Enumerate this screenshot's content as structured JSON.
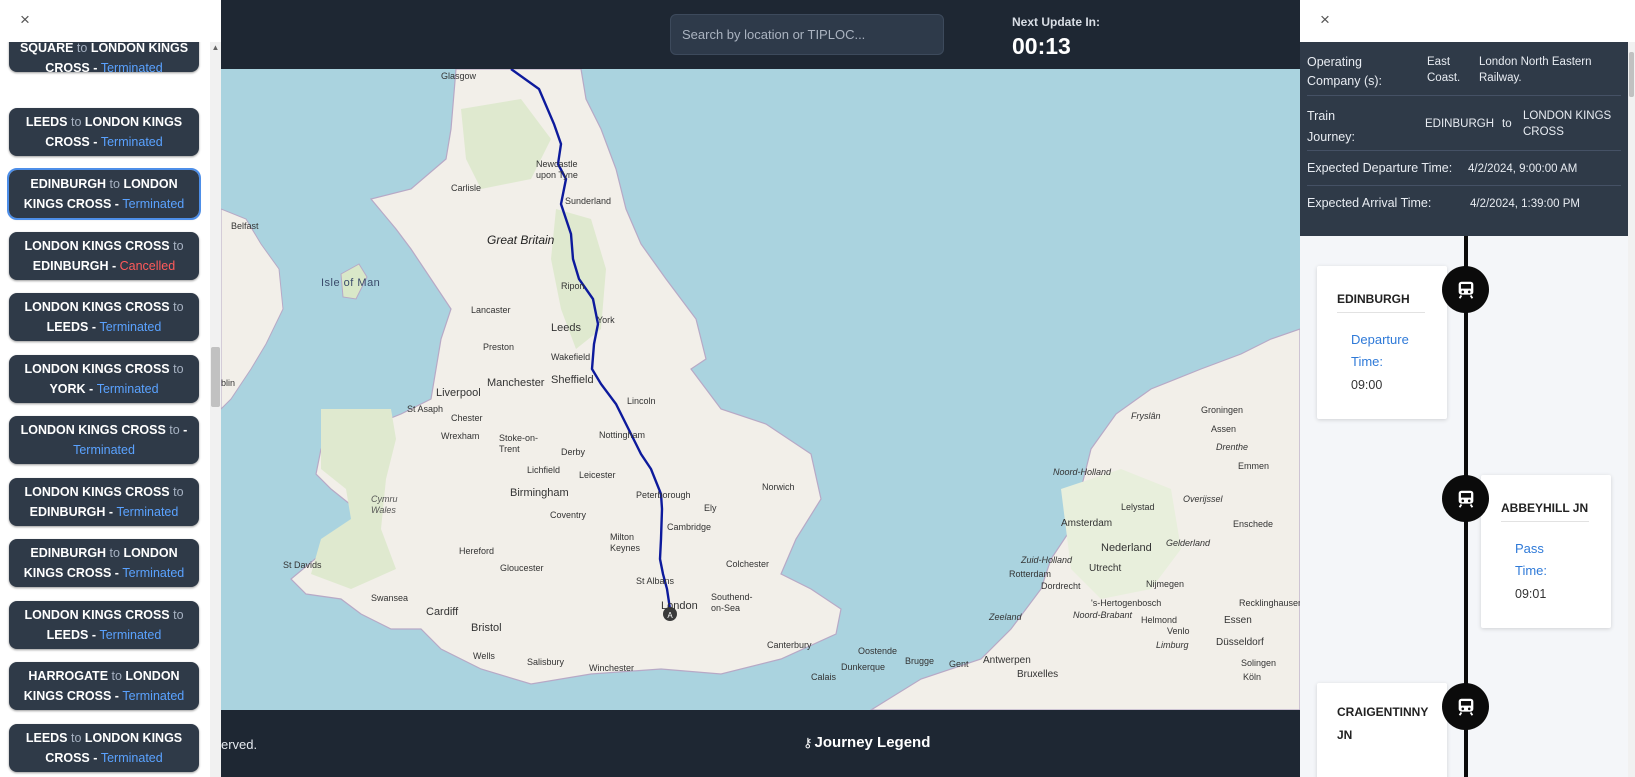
{
  "left_panel": {
    "close_label": "×",
    "journeys": [
      {
        "from": "BRADFORD FORSTER SQUARE",
        "to": "LONDON KINGS CROSS",
        "status": "Terminated"
      },
      {
        "from": "LEEDS",
        "to": "LONDON KINGS CROSS",
        "status": "Terminated"
      },
      {
        "from": "EDINBURGH",
        "to": "LONDON KINGS CROSS",
        "status": "Terminated"
      },
      {
        "from": "LONDON KINGS CROSS",
        "to": "EDINBURGH",
        "status": "Cancelled"
      },
      {
        "from": "LONDON KINGS CROSS",
        "to": "LEEDS",
        "status": "Terminated"
      },
      {
        "from": "LONDON KINGS CROSS",
        "to": "YORK",
        "status": "Terminated"
      },
      {
        "from": "LONDON KINGS CROSS",
        "to": "",
        "status": "Terminated"
      },
      {
        "from": "LONDON KINGS CROSS",
        "to": "EDINBURGH",
        "status": "Terminated"
      },
      {
        "from": "EDINBURGH",
        "to": "LONDON KINGS CROSS",
        "status": "Terminated"
      },
      {
        "from": "LONDON KINGS CROSS",
        "to": "LEEDS",
        "status": "Terminated"
      },
      {
        "from": "HARROGATE",
        "to": "LONDON KINGS CROSS",
        "status": "Terminated"
      },
      {
        "from": "LEEDS",
        "to": "LONDON KINGS CROSS",
        "status": "Terminated"
      }
    ],
    "to_word": "to",
    "separator": "-"
  },
  "top_bar": {
    "search_placeholder": "Search by location or TIPLOC...",
    "next_update_label": "Next Update In:",
    "next_update_value": "00:13"
  },
  "map": {
    "labels": [
      "Glasgow",
      "Newcastle upon Tyne",
      "Carlisle",
      "Sunderland",
      "Great Britain",
      "Belfast",
      "Isle of Man",
      "Ripon",
      "Lancaster",
      "York",
      "Leeds",
      "Preston",
      "Wakefield",
      "Manchester",
      "Sheffield",
      "Liverpool",
      "St Asaph",
      "Chester",
      "Lincoln",
      "Wrexham",
      "Nottingham",
      "Stoke-on-Trent",
      "Derby",
      "Lichfield",
      "Leicester",
      "Birmingham",
      "Coventry",
      "Cymru Wales",
      "Peterborough",
      "Ely",
      "Norwich",
      "Cambridge",
      "Hereford",
      "Milton Keynes",
      "Gloucester",
      "Colchester",
      "St Davids",
      "St Albans",
      "London",
      "Southend-on-Sea",
      "Swansea",
      "Cardiff",
      "Bristol",
      "Wells",
      "Salisbury",
      "Winchester",
      "Canterbury",
      "Dunkerque",
      "Oostende",
      "Brugge",
      "Gent",
      "Antwerpen",
      "Bruxelles",
      "Calais",
      "Amsterdam",
      "Nederland",
      "Lelystad",
      "Utrecht",
      "Dordrecht",
      "Nijmegen",
      "Rotterdam",
      "Zeeland",
      "'s-Hertogenbosch",
      "Noord-Brabant",
      "Helmond",
      "Venlo",
      "Essen",
      "Düsseldorf",
      "Recklinghausen",
      "Groningen",
      "Assen",
      "Drenthe",
      "Emmen",
      "Overijssel",
      "Enschede",
      "Gelderland",
      "Zuid-Holland",
      "Noord-Holland",
      "Fryslân",
      "Köln",
      "Solingen",
      "Limburg",
      "blin"
    ],
    "train_marker": "A",
    "route_color": "#0d1a9c"
  },
  "bottom_bar": {
    "copyright": "erved.",
    "legend_label": "Journey Legend",
    "legend_icon": "key-icon"
  },
  "right_panel": {
    "close_label": "×",
    "details": {
      "operating_label": "Operating Company (s):",
      "operating_value_1": "East Coast.",
      "operating_value_2": "London North Eastern Railway.",
      "journey_label": "Train Journey:",
      "journey_from": "EDINBURGH",
      "journey_to_word": "to",
      "journey_to": "LONDON KINGS CROSS",
      "departure_label": "Expected Departure Time:",
      "departure_value": "4/2/2024, 9:00:00 AM",
      "arrival_label": "Expected Arrival Time:",
      "arrival_value": "4/2/2024, 1:39:00 PM"
    },
    "stops": [
      {
        "name": "EDINBURGH",
        "time_label": "Departure Time:",
        "time": "09:00"
      },
      {
        "name": "ABBEYHILL JN",
        "time_label": "Pass Time:",
        "time": "09:01"
      },
      {
        "name": "CRAIGENTINNY JN",
        "time_label": "",
        "time": ""
      }
    ],
    "stop_icon": "train-icon"
  },
  "colors": {
    "dark_bg": "#1e2733",
    "card_bg": "#2f3a48",
    "terminated": "#5aa2ff",
    "cancelled": "#ff5a5a",
    "sea": "#aad3df",
    "land": "#f2efe9",
    "accent_blue": "#2f7ad8"
  }
}
